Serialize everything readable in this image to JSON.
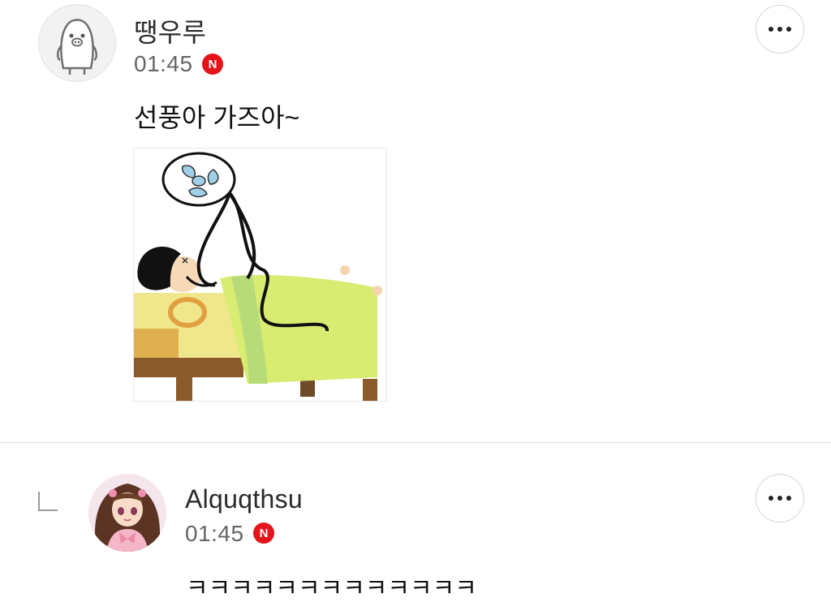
{
  "comments": [
    {
      "author": "땡우루",
      "time": "01:45",
      "badge": "N",
      "text": "선풍아 가즈아~",
      "avatar_icon": "pig-character-icon",
      "image_icon": "person-in-bed-with-fan-illustration"
    },
    {
      "author": "Alquqthsu",
      "time": "01:45",
      "badge": "N",
      "text": "ㅋㅋㅋㅋㅋㅋㅋㅋㅋㅋㅋㅋㅋ",
      "avatar_icon": "anime-girl-avatar-icon",
      "is_reply": true
    }
  ],
  "colors": {
    "badge": "#e4141a",
    "divider": "#dcdcdc",
    "blanket": "#d9ec72",
    "bed": "#f0e68c"
  }
}
